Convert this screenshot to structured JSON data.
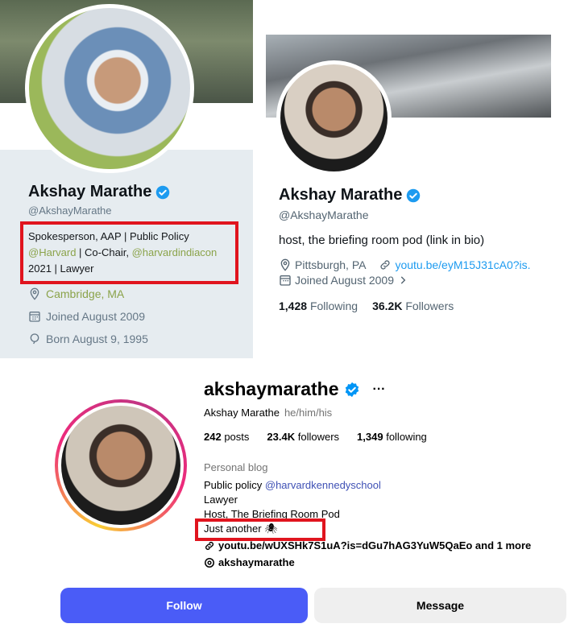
{
  "old_twitter": {
    "name": "Akshay Marathe",
    "handle": "@AkshayMarathe",
    "bio_line1": "Spokesperson, AAP | Public Policy",
    "bio_mention1": "@Harvard",
    "bio_mid": " | Co-Chair, ",
    "bio_mention2": "@harvardindiacon",
    "bio_line3": "2021 | Lawyer",
    "location": "Cambridge, MA",
    "joined": "Joined August 2009",
    "born": "Born August 9, 1995",
    "link_color": "#8ba34a"
  },
  "new_twitter": {
    "name": "Akshay Marathe",
    "handle": "@AkshayMarathe",
    "bio": "host, the briefing room pod (link in bio)",
    "location": "Pittsburgh, PA",
    "website": "youtu.be/eyM15J31cA0?is.",
    "joined": "Joined August 2009",
    "following_count": "1,428",
    "following_label": "Following",
    "followers_count": "36.2K",
    "followers_label": "Followers",
    "link_color": "#1d9bf0"
  },
  "instagram": {
    "username": "akshaymarathe",
    "more": "···",
    "full_name": "Akshay Marathe",
    "pronouns": "he/him/his",
    "posts_count": "242",
    "posts_label": "posts",
    "followers_count": "23.4K",
    "followers_label": "followers",
    "following_count": "1,349",
    "following_label": "following",
    "category": "Personal blog",
    "bio_line1_text": "Public policy ",
    "bio_line1_mention": "@harvardkennedyschool",
    "bio_line2": "Lawyer",
    "bio_line3": "Host, The Briefing Room Pod",
    "bio_line4": "Just another",
    "bio_line4_emoji": "🕷",
    "external_link": "youtu.be/wUXSHk7S1uA?is=dGu7hAG3YuW5QaEo and 1 more",
    "threads_handle": "akshaymarathe",
    "follow_label": "Follow",
    "message_label": "Message",
    "accent": "#4a5cf7"
  },
  "highlight_color": "#e0141e"
}
